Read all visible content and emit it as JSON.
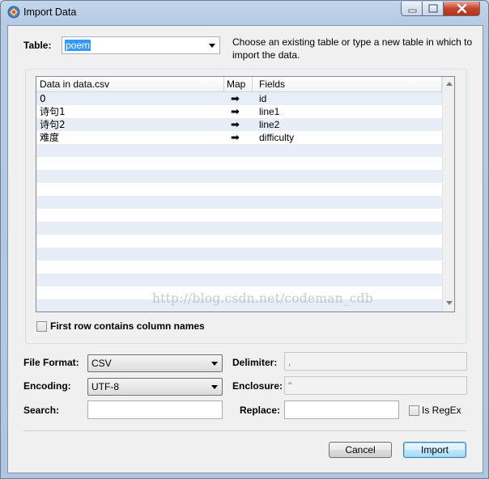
{
  "window": {
    "title": "Import Data"
  },
  "table": {
    "label": "Table:",
    "value": "poem",
    "hint": "Choose an existing table or type a new table in which to import the data."
  },
  "grid": {
    "headers": [
      "Data in data.csv",
      "Map",
      "Fields"
    ],
    "rows": [
      {
        "source": "0",
        "map": "➡",
        "field": "id"
      },
      {
        "source": "诗句1",
        "map": "➡",
        "field": "line1"
      },
      {
        "source": "诗句2",
        "map": "➡",
        "field": "line2"
      },
      {
        "source": "难度",
        "map": "➡",
        "field": "difficulty"
      }
    ],
    "watermark": "http://blog.csdn.net/codeman_cdb"
  },
  "first_row": {
    "label": "First row contains column names",
    "checked": false
  },
  "options": {
    "file_format_label": "File Format:",
    "file_format_value": "CSV",
    "encoding_label": "Encoding:",
    "encoding_value": "UTF-8",
    "search_label": "Search:",
    "search_value": "",
    "delimiter_label": "Delimiter:",
    "delimiter_value": ",",
    "enclosure_label": "Enclosure:",
    "enclosure_value": "\"",
    "replace_label": "Replace:",
    "replace_value": "",
    "regex_label": "Is RegEx",
    "regex_checked": false
  },
  "buttons": {
    "cancel": "Cancel",
    "import": "Import"
  }
}
